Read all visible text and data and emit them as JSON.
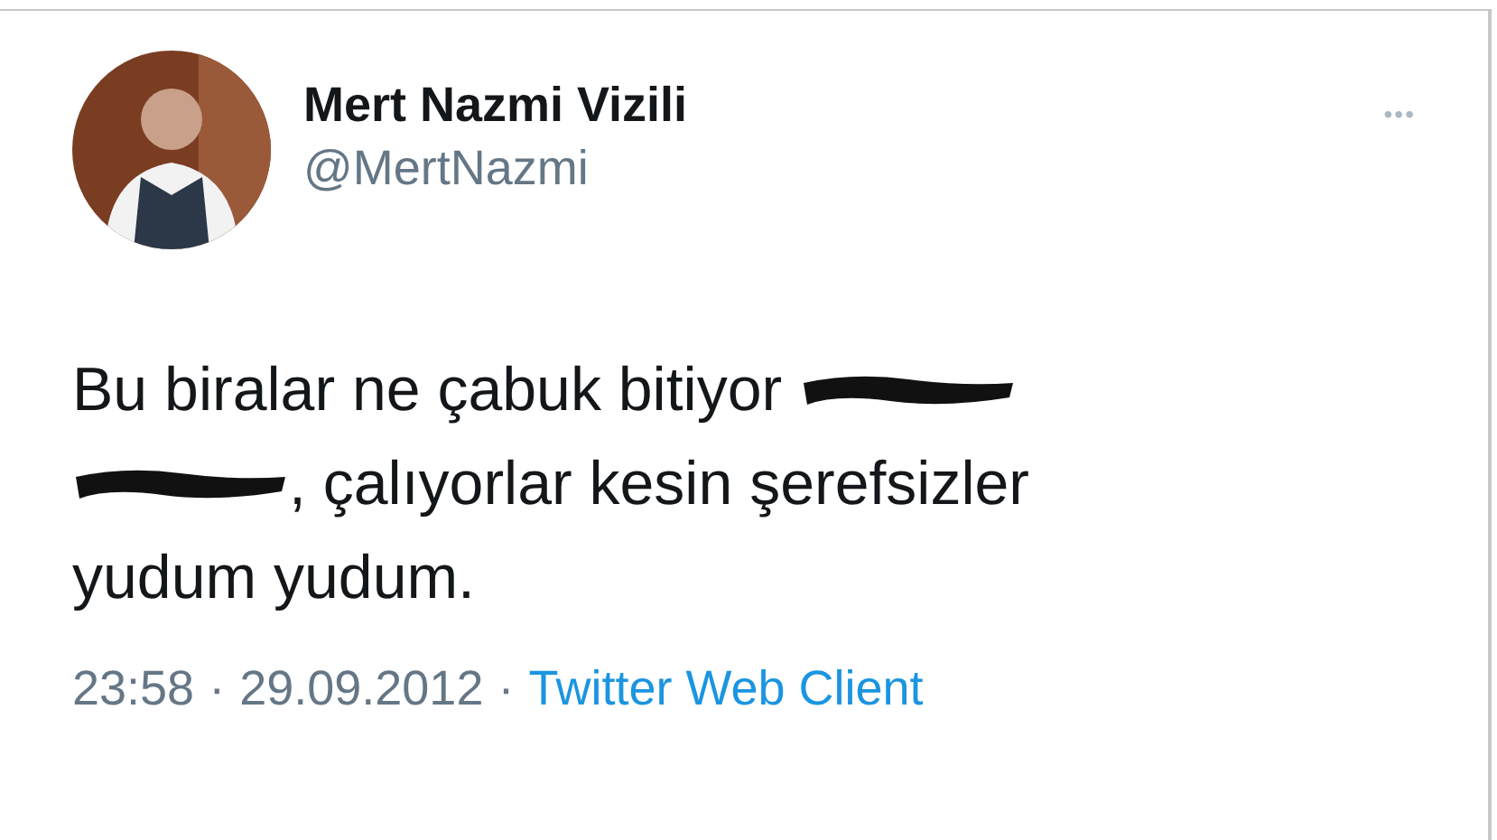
{
  "author": {
    "name": "Mert Nazmi Vizili",
    "handle": "@MertNazmi"
  },
  "more_label": "•••",
  "body_lines": [
    [
      {
        "kind": "text",
        "text": "Bu biralar ne çabuk bitiyor "
      },
      {
        "kind": "redaction"
      }
    ],
    [
      {
        "kind": "redaction"
      },
      {
        "kind": "text",
        "text": ", çalıyorlar kesin şerefsizler"
      }
    ],
    [
      {
        "kind": "text",
        "text": "yudum yudum."
      }
    ]
  ],
  "meta": {
    "time": "23:58",
    "date": "29.09.2012",
    "separator": "·",
    "source": "Twitter Web Client"
  }
}
